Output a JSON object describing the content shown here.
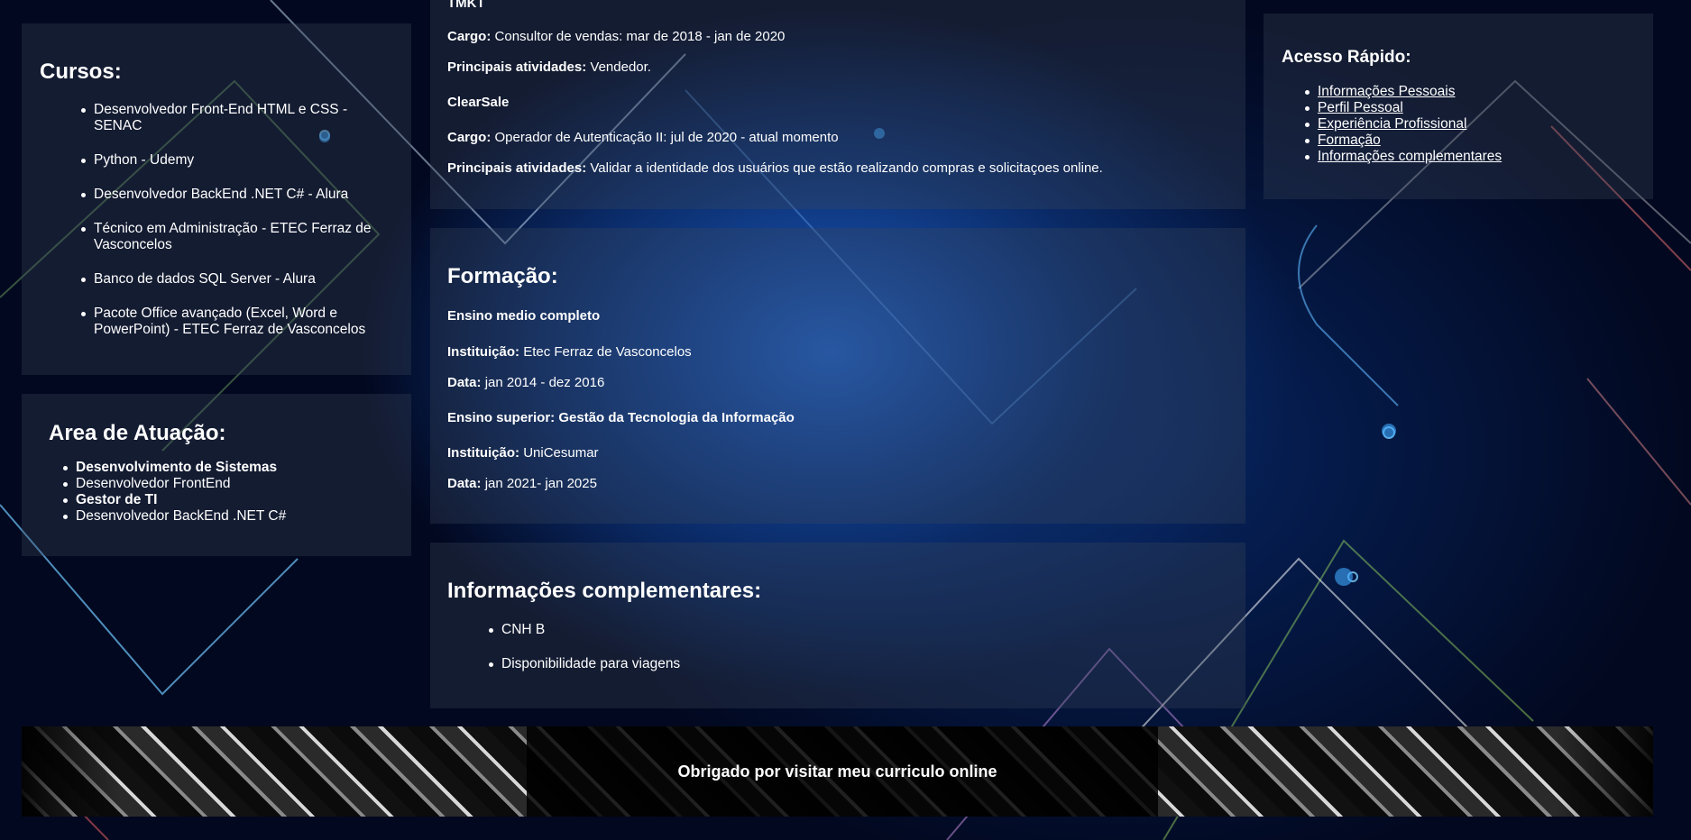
{
  "left": {
    "cursos": {
      "title": "Cursos:",
      "items": [
        "Desenvolvedor Front-End HTML e CSS - SENAC",
        "Python - Udemy",
        "Desenvolvedor BackEnd .NET C# - Alura",
        "Técnico em Administração - ETEC Ferraz de Vasconcelos",
        "Banco de dados SQL Server - Alura",
        "Pacote Office avançado (Excel, Word e PowerPoint) - ETEC Ferraz de Vasconcelos"
      ]
    },
    "area": {
      "title": "Area de Atuação:",
      "items": [
        {
          "text": "Desenvolvimento de Sistemas",
          "bold": true
        },
        {
          "text": "Desenvolvedor FrontEnd",
          "bold": false
        },
        {
          "text": "Gestor de TI",
          "bold": true
        },
        {
          "text": "Desenvolvedor BackEnd .NET C#",
          "bold": false
        }
      ]
    }
  },
  "experiencia": {
    "company1": "TMKT",
    "cargo_label": "Cargo:",
    "atividades_label": "Principais atividades:",
    "cargo1": "Consultor de vendas: mar de 2018 - jan de 2020",
    "atividades1": "Vendedor.",
    "company2": "ClearSale",
    "cargo2": "Operador de Autenticação II: jul de 2020 - atual momento",
    "atividades2": "Validar a identidade dos usuários que estão realizando compras e solicitaçoes online."
  },
  "formacao": {
    "title": "Formação:",
    "curso1": "Ensino medio completo",
    "instituicao_label": "Instituição:",
    "data_label": "Data:",
    "instituicao1": "Etec Ferraz de Vasconcelos",
    "data1": "jan 2014 - dez 2016",
    "curso2": "Ensino superior: Gestão da Tecnologia da Informação",
    "instituicao2": "UniCesumar",
    "data2": "jan 2021- jan 2025"
  },
  "info": {
    "title": "Informações complementares:",
    "items": [
      "CNH B",
      "Disponibilidade para viagens"
    ]
  },
  "acesso": {
    "title": "Acesso Rápido:",
    "links": [
      "Informações Pessoais",
      "Perfil Pessoal",
      "Experiência Profissional",
      "Formação",
      "Informações complementares"
    ]
  },
  "footer": {
    "text": "Obrigado por visitar meu curriculo online"
  }
}
